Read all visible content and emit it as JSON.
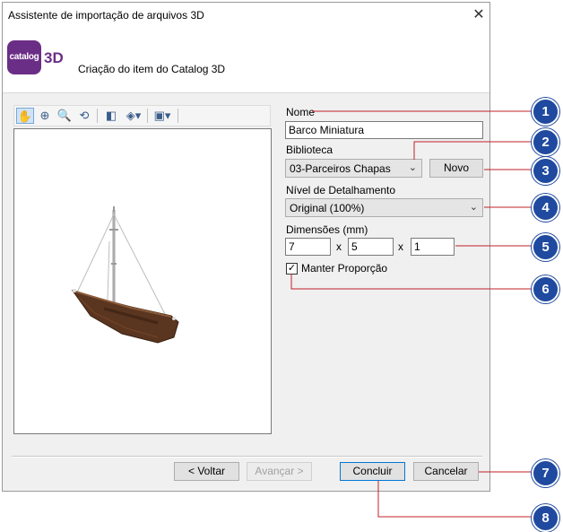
{
  "window": {
    "title": "Assistente de importação de arquivos 3D",
    "close_glyph": "✕",
    "header_subtitle": "Criação do item do Catalog 3D",
    "logo_text": "catalog",
    "logo_suffix": "3D"
  },
  "toolbar": {
    "icons": [
      "pan-icon",
      "zoom-area-icon",
      "zoom-icon",
      "orbit-icon",
      "view-cube-icon",
      "render-mode-icon",
      "box-view-icon"
    ]
  },
  "form": {
    "name_label": "Nome",
    "name_value": "Barco Miniatura",
    "library_label": "Biblioteca",
    "library_value": "03-Parceiros Chapas",
    "new_button": "Novo",
    "detail_label": "Nível de Detalhamento",
    "detail_value": "Original (100%)",
    "dimensions_label": "Dimensões (mm)",
    "dim_x": "7",
    "dim_y": "5",
    "dim_z": "1",
    "times": "x",
    "keep_ratio_label": "Manter Proporção",
    "keep_ratio_checked": true
  },
  "footer": {
    "back": "< Voltar",
    "next": "Avançar >",
    "finish": "Concluir",
    "cancel": "Cancelar"
  },
  "callouts": [
    "1",
    "2",
    "3",
    "4",
    "5",
    "6",
    "7",
    "8"
  ],
  "colors": {
    "callout": "#1f4aa0",
    "callout_line": "#c0202a",
    "brand": "#6b2e86",
    "hull": "#5a3520"
  }
}
